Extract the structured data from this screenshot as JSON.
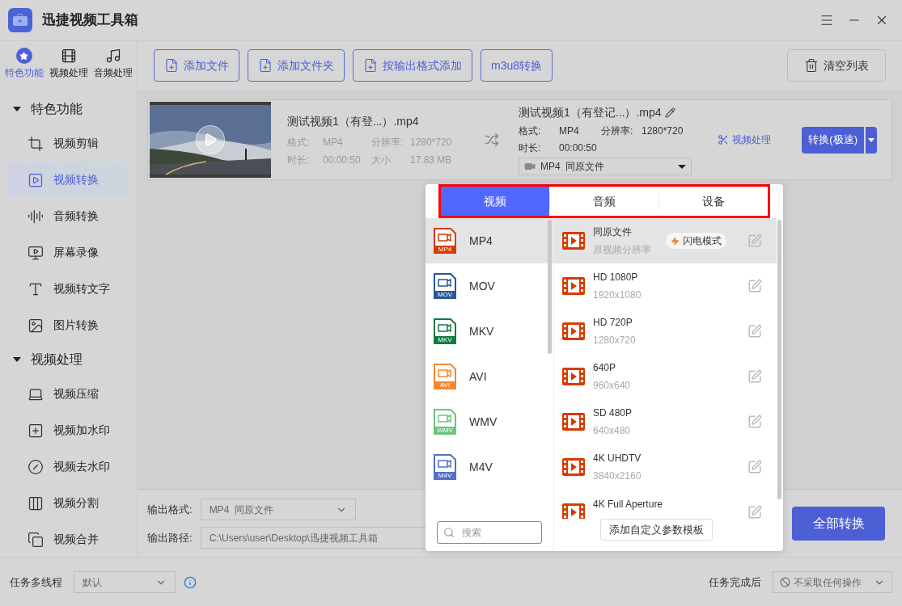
{
  "window": {
    "title": "迅捷视频工具箱"
  },
  "nav_tabs": [
    {
      "label": "特色功能",
      "selected": true
    },
    {
      "label": "视频处理",
      "selected": false
    },
    {
      "label": "音频处理",
      "selected": false
    }
  ],
  "sidebar": {
    "groups": [
      {
        "label": "特色功能",
        "expanded": true,
        "items": [
          {
            "label": "视频剪辑",
            "selected": false
          },
          {
            "label": "视频转换",
            "selected": true
          },
          {
            "label": "音频转换",
            "selected": false
          },
          {
            "label": "屏幕录像",
            "selected": false
          },
          {
            "label": "视频转文字",
            "selected": false
          },
          {
            "label": "图片转换",
            "selected": false
          }
        ]
      },
      {
        "label": "视频处理",
        "expanded": true,
        "items": [
          {
            "label": "视频压缩",
            "selected": false
          },
          {
            "label": "视频加水印",
            "selected": false
          },
          {
            "label": "视频去水印",
            "selected": false
          },
          {
            "label": "视频分割",
            "selected": false
          },
          {
            "label": "视频合并",
            "selected": false
          }
        ]
      }
    ]
  },
  "toolbar": {
    "buttons": [
      {
        "label": "添加文件",
        "kind": "add"
      },
      {
        "label": "添加文件夹",
        "kind": "add"
      },
      {
        "label": "按输出格式添加",
        "kind": "add"
      },
      {
        "label": "m3u8转换",
        "kind": "plain"
      }
    ],
    "clear_button": "清空列表"
  },
  "file": {
    "source": {
      "name": "测试视频1（有登...）.mp4",
      "format_label": "格式:",
      "format": "MP4",
      "resolution_label": "分辨率:",
      "resolution": "1280*720",
      "duration_label": "时长:",
      "duration": "00:00:50",
      "size_label": "大小:",
      "size": "17.83 MB"
    },
    "output": {
      "name": "测试视频1（有登记...）.mp4",
      "format_label": "格式:",
      "format": "MP4",
      "resolution_label": "分辨率:",
      "resolution": "1280*720",
      "duration_label": "时长:",
      "duration": "00:00:50",
      "select": "MP4  同原文件"
    },
    "process_link": "视频处理",
    "convert_button": "转换(极速)"
  },
  "output_settings": {
    "format_label": "输出格式:",
    "format_value": "MP4  同原文件",
    "path_label": "输出路径:",
    "path_value": "C:\\Users\\user\\Desktop\\迅捷视频工具箱"
  },
  "convert_all_button": "全部转换",
  "format_popup": {
    "tabs": [
      {
        "label": "视频",
        "selected": true
      },
      {
        "label": "音频",
        "selected": false
      },
      {
        "label": "设备",
        "selected": false
      }
    ],
    "formats": [
      {
        "label": "MP4",
        "badge": "MP4",
        "color": "#d83b01",
        "selected": true
      },
      {
        "label": "MOV",
        "badge": "MOV",
        "color": "#2b579a",
        "selected": false
      },
      {
        "label": "MKV",
        "badge": "MKV",
        "color": "#107c41",
        "selected": false
      },
      {
        "label": "AVI",
        "badge": "AVI",
        "color": "#f7872f",
        "selected": false
      },
      {
        "label": "WMV",
        "badge": "WMV",
        "color": "#70c27f",
        "selected": false
      },
      {
        "label": "M4V",
        "badge": "M4V",
        "color": "#5470c6",
        "selected": false
      }
    ],
    "presets": [
      {
        "name": "同原文件",
        "resolution": "原视频分辨率",
        "badge": "闪电模式",
        "selected": true
      },
      {
        "name": "HD 1080P",
        "resolution": "1920x1080",
        "selected": false
      },
      {
        "name": "HD 720P",
        "resolution": "1280x720",
        "selected": false
      },
      {
        "name": "640P",
        "resolution": "960x640",
        "selected": false
      },
      {
        "name": "SD 480P",
        "resolution": "640x480",
        "selected": false
      },
      {
        "name": "4K UHDTV",
        "resolution": "3840x2160",
        "selected": false
      },
      {
        "name": "4K Full Aperture",
        "selected": false
      }
    ],
    "search": {
      "placeholder": "搜索"
    },
    "add_template_button": "添加自定义参数模板"
  },
  "status_bar": {
    "threads_label": "任务多线程",
    "threads_value": "默认",
    "after_label": "任务完成后",
    "after_value": "不采取任何操作"
  }
}
